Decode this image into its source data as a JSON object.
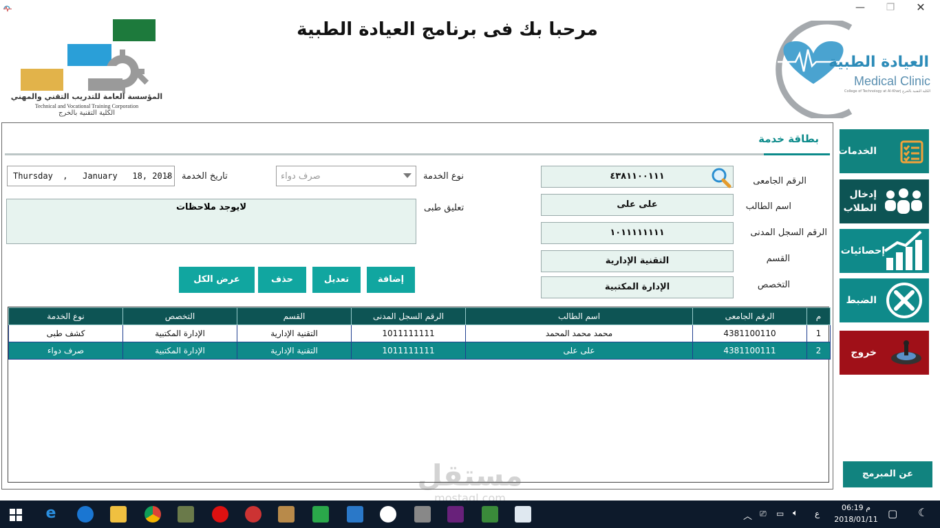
{
  "window": {
    "minimize": "—",
    "maximize": "❐",
    "close": "✕"
  },
  "header": {
    "welcome": "مرحبا بك فى برنامج  العيادة الطبية",
    "left_logo": {
      "arabic": "المؤسسة العامة للتدريب التقني والمهني",
      "english": "Technical and Vocational Training Corporation",
      "college": "الكلية التقنية بالخرج"
    },
    "right_logo": {
      "arabic": "العيادة الطبية",
      "english": "Medical Clinic",
      "sub": "College of Technology at Al-Kharj الكلية التقنية بالخرج"
    }
  },
  "card": {
    "title": "بطاقة خدمة",
    "labels": {
      "university_id": "الرقم الجامعى",
      "student_name": "اسم الطالب",
      "civil_id": "الرقم السجل المدنى",
      "department": "القسم",
      "specialty": "التخصص",
      "service_type": "نوع الخدمة",
      "service_date": "تاريخ الخدمة",
      "medical_comment": "تعليق طبى"
    },
    "values": {
      "university_id": "٤٣٨١١٠٠١١١",
      "student_name": "على على",
      "civil_id": "١٠١١١١١١١١",
      "department": "التقنية الإدارية",
      "specialty": "الإدارة المكتبية",
      "service_type_placeholder": "صرف دواء",
      "service_date": "Thursday  ,   January   18, 2018",
      "medical_comment": "لايوجد ملاحظات"
    },
    "buttons": {
      "add": "إضافة",
      "edit": "تعديل",
      "delete": "حذف",
      "show_all": "عرض الكل"
    }
  },
  "grid": {
    "columns": [
      "م",
      "الرقم الجامعى",
      "اسم الطالب",
      "الرقم السجل المدنى",
      "القسم",
      "التخصص",
      "نوع الخدمة"
    ],
    "rows": [
      [
        "1",
        "4381100110",
        "محمد محمد المحمد",
        "1011111111",
        "التقنية الإدارية",
        "الإدارة المكتبية",
        "كشف طبى"
      ],
      [
        "2",
        "4381100111",
        "على على",
        "1011111111",
        "التقنية الإدارية",
        "الإدارة المكتبية",
        "صرف دواء"
      ]
    ],
    "selected_row": 2
  },
  "side_menu": {
    "services": "الخدمات",
    "students": "إدخال الطلاب",
    "stats": "إحصائيات",
    "settings": "الضبط",
    "exit": "خروج",
    "about": "عن المبرمج"
  },
  "taskbar": {
    "time": "06:19",
    "ampm": "م",
    "date": "2018/01/11",
    "lang": "ع"
  },
  "watermark": {
    "arabic": "مستقل",
    "latin": "mostaql.com"
  },
  "colors": {
    "teal": "#0b8a8a",
    "teal_dark": "#0d5454",
    "button": "#11a6a0",
    "exit_red": "#a01018",
    "field_bg": "#e7f3ef"
  }
}
